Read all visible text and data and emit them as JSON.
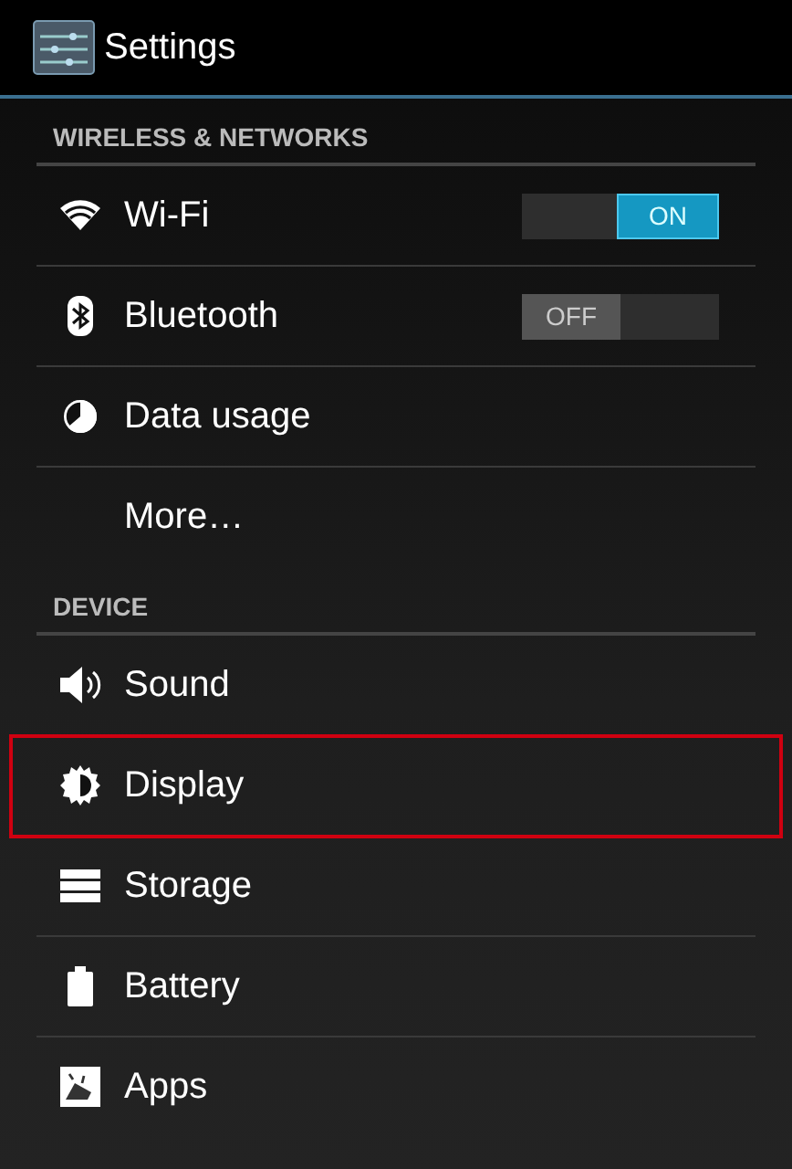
{
  "action_bar": {
    "title": "Settings"
  },
  "sections": [
    {
      "header": "WIRELESS & NETWORKS",
      "items": [
        {
          "label": "Wi-Fi",
          "kind": "toggle",
          "on": true,
          "switch_text": "ON",
          "highlighted": false
        },
        {
          "label": "Bluetooth",
          "kind": "toggle",
          "on": false,
          "switch_text": "OFF",
          "highlighted": false
        },
        {
          "label": "Data usage",
          "kind": "plain",
          "highlighted": false
        },
        {
          "label": "More…",
          "kind": "plain",
          "highlighted": false
        }
      ]
    },
    {
      "header": "DEVICE",
      "items": [
        {
          "label": "Sound",
          "kind": "plain",
          "highlighted": false
        },
        {
          "label": "Display",
          "kind": "plain",
          "highlighted": true
        },
        {
          "label": "Storage",
          "kind": "plain",
          "highlighted": false
        },
        {
          "label": "Battery",
          "kind": "plain",
          "highlighted": false
        },
        {
          "label": "Apps",
          "kind": "plain",
          "highlighted": false
        }
      ]
    }
  ]
}
